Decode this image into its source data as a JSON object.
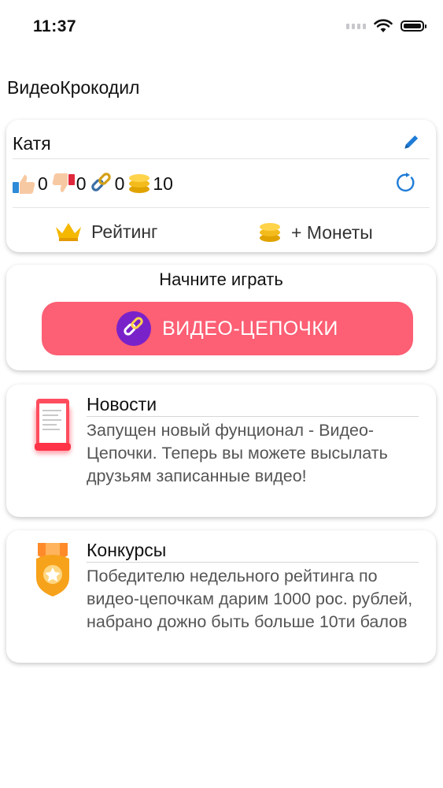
{
  "status_bar": {
    "time": "11:37"
  },
  "app_title": "ВидеоКрокодил",
  "profile": {
    "name": "Катя",
    "stats": {
      "likes": "0",
      "dislikes": "0",
      "chains": "0",
      "coins": "10"
    },
    "rating_label": "Рейтинг",
    "coins_label": "+ Монеты"
  },
  "play": {
    "title": "Начните играть",
    "button_label": "ВИДЕО-ЦЕПОЧКИ"
  },
  "news": {
    "title": "Новости",
    "text": "Запущен новый фунционал - Видео-Цепочки. Теперь вы можете высылать друзьям записанные видео!"
  },
  "contest": {
    "title": "Конкурсы",
    "text": "Победителю недельного рейтинга по видео-цепочкам дарим 1000 рос. рублей, набрано дожно быть больше 10ти балов"
  },
  "colors": {
    "accent": "#fd5f74",
    "link_blue": "#1e7bd6"
  },
  "icons": [
    "signal-icon",
    "wifi-icon",
    "battery-icon",
    "edit-icon",
    "refresh-icon",
    "thumbs-up-icon",
    "thumbs-down-icon",
    "link-icon",
    "coins-icon",
    "crown-icon",
    "news-icon",
    "medal-icon"
  ]
}
